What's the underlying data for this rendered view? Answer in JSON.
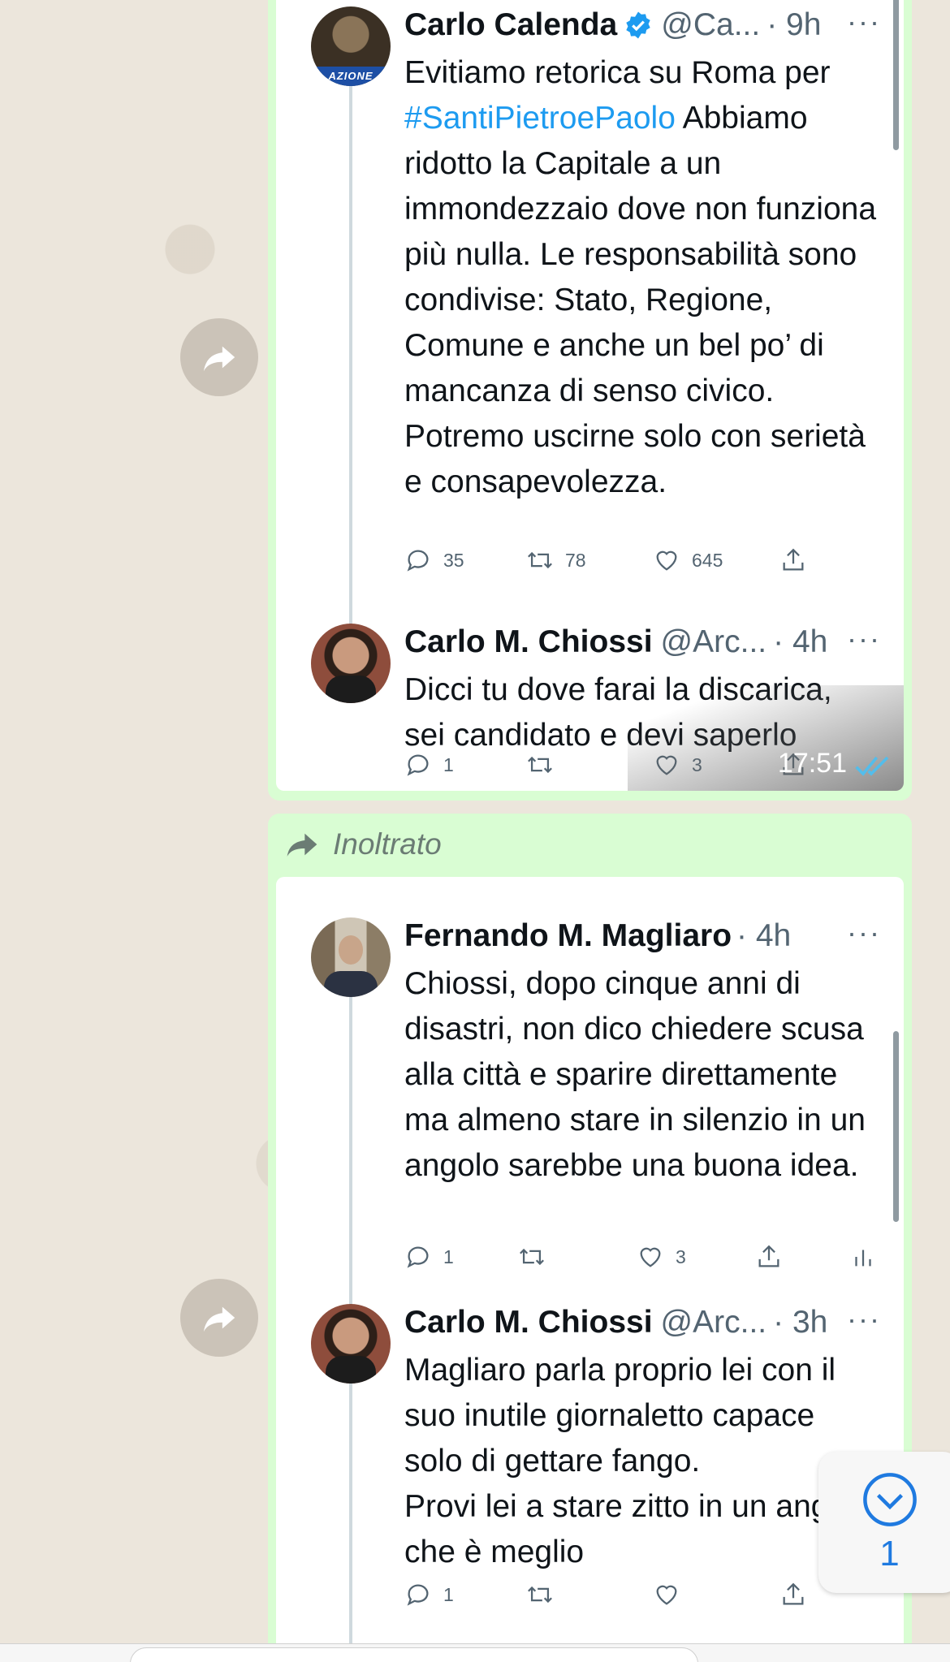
{
  "messages": [
    {
      "time": "17:51",
      "tweets": [
        {
          "name": "Carlo Calenda",
          "verified": true,
          "handle": "@Ca...",
          "time": "· 9h",
          "text_prefix": "Evitiamo retorica su Roma per",
          "hashtag": "#SantiPietroePaolo",
          "text": "Abbiamo ridotto la Capitale a un immondezzaio dove non funziona più nulla. Le responsabilità sono condivise: Stato, Regione, Comune e anche un bel po’ di mancanza di senso civico. Potremo uscirne solo con serietà e consapevolezza.",
          "avatar_badge": "AZIONE",
          "replies": "35",
          "retweets": "78",
          "likes": "645"
        },
        {
          "name": "Carlo M. Chiossi",
          "handle": "@Arc...",
          "time": "· 4h",
          "text": "Dicci tu dove farai la discarica, sei candidato e devi saperlo",
          "replies": "1",
          "likes": "3"
        }
      ]
    },
    {
      "label": "Inoltrato",
      "tweets": [
        {
          "name": "Fernando M. Magliaro",
          "time": "· 4h",
          "text": "Chiossi, dopo cinque anni di disastri, non dico chiedere scusa alla città e sparire direttamente ma almeno stare in silenzio in un angolo sarebbe una buona idea.",
          "replies": "1",
          "likes": "3"
        },
        {
          "name": "Carlo M. Chiossi",
          "handle": "@Arc...",
          "time": "· 3h",
          "text": "Magliaro parla proprio lei con il suo inutile giornaletto capace solo di gettare fango.\nProvi lei a stare zitto in un angolo  che è meglio",
          "replies": "1"
        }
      ]
    }
  ],
  "scroll_down_badge": "1",
  "more_icon": "···",
  "colors": {
    "bubble": "#d9fdd3",
    "link": "#1d9bf0",
    "read_ticks": "#53bdeb",
    "badge_blue": "#1f7ae0"
  }
}
